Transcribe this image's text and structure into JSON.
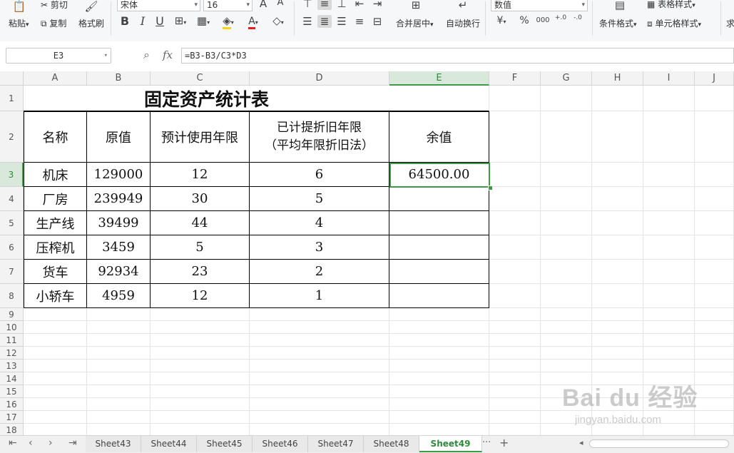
{
  "ribbon": {
    "paste": "粘贴",
    "cut": "剪切",
    "copy": "复制",
    "format_painter": "格式刷",
    "font_name": "宋体",
    "font_size": "16",
    "merge_center": "合并居中",
    "wrap_text": "自动换行",
    "number_format": "数值",
    "conditional_format": "条件格式",
    "table_style": "表格样式",
    "cell_style": "单元格样式",
    "sum": "求",
    "bold": "B",
    "italic": "I",
    "underline": "U",
    "grow_font": "A",
    "shrink_font": "A",
    "currency": "¥",
    "percent": "%",
    "thousands": "000",
    "inc_decimal": "+.0",
    "dec_decimal": "-.0"
  },
  "formula_bar": {
    "name_box": "E3",
    "fx_label": "fx",
    "formula": "=B3-B3/C3*D3"
  },
  "columns": [
    "A",
    "B",
    "C",
    "D",
    "E",
    "F",
    "G",
    "H",
    "I",
    "J"
  ],
  "rows": [
    "1",
    "2",
    "3",
    "4",
    "5",
    "6",
    "7",
    "8",
    "9",
    "10",
    "11",
    "12",
    "13",
    "14",
    "15",
    "16",
    "17",
    "18"
  ],
  "table": {
    "title": "固定资产统计表",
    "headers": {
      "name": "名称",
      "original": "原值",
      "years": "预计使用年限",
      "elapsed_line1": "已计提折旧年限",
      "elapsed_line2": "（平均年限折旧法）",
      "residual": "余值"
    },
    "rows": [
      {
        "name": "机床",
        "original": "129000",
        "years": "12",
        "elapsed": "6",
        "residual": "64500.00"
      },
      {
        "name": "厂房",
        "original": "239949",
        "years": "30",
        "elapsed": "5",
        "residual": ""
      },
      {
        "name": "生产线",
        "original": "39499",
        "years": "44",
        "elapsed": "4",
        "residual": ""
      },
      {
        "name": "压榨机",
        "original": "3459",
        "years": "5",
        "elapsed": "3",
        "residual": ""
      },
      {
        "name": "货车",
        "original": "92934",
        "years": "23",
        "elapsed": "2",
        "residual": ""
      },
      {
        "name": "小轿车",
        "original": "4959",
        "years": "12",
        "elapsed": "1",
        "residual": ""
      }
    ]
  },
  "sheet_tabs": [
    "Sheet43",
    "Sheet44",
    "Sheet45",
    "Sheet46",
    "Sheet47",
    "Sheet48",
    "Sheet49"
  ],
  "active_sheet": "Sheet49",
  "tab_more": "···",
  "tab_add": "+",
  "watermark": {
    "main": "Bai du 经验",
    "sub": "jingyan.baidu.com"
  },
  "colors": {
    "accent": "#3c9a48",
    "header_active_bg": "#d8e9dc"
  }
}
